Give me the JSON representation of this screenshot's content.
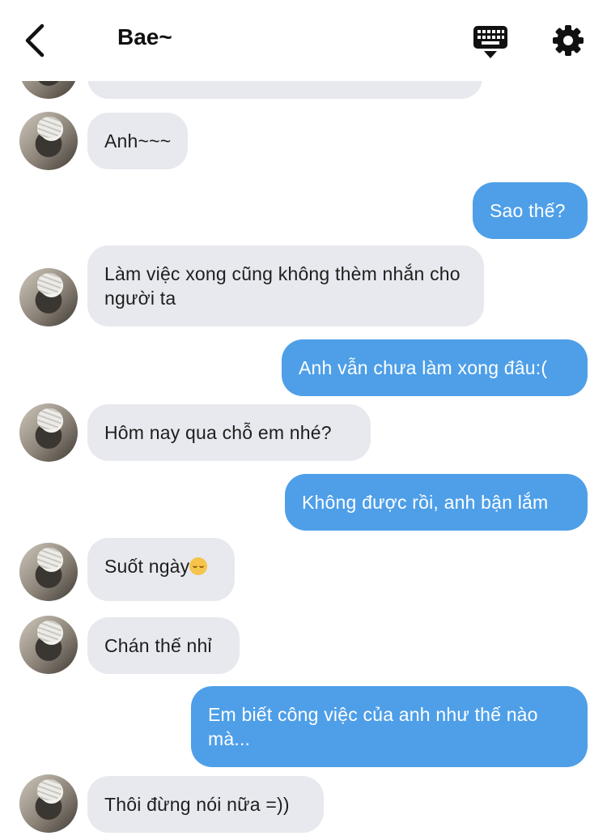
{
  "header": {
    "title": "Bae~",
    "back_icon": "chevron-left-icon",
    "keyboard_icon": "keyboard-icon",
    "settings_icon": "gear-icon"
  },
  "colors": {
    "outgoing_bubble": "#4e9fe8",
    "incoming_bubble": "#e7e9ee"
  },
  "messages": [
    {
      "side": "in",
      "text": ""
    },
    {
      "side": "in",
      "text": "Anh~~~"
    },
    {
      "side": "out",
      "text": "Sao thế?"
    },
    {
      "side": "in",
      "text": "Làm việc xong cũng không thèm nhắn cho người ta"
    },
    {
      "side": "out",
      "text": "Anh vẫn chưa làm xong đâu:("
    },
    {
      "side": "in",
      "text": "Hôm nay qua chỗ em nhé?"
    },
    {
      "side": "out",
      "text": "Không được rồi, anh bận lắm"
    },
    {
      "side": "in",
      "text": "Suốt ngày",
      "emoji": "relieved-face-emoji"
    },
    {
      "side": "in",
      "text": "Chán thế nhỉ"
    },
    {
      "side": "out",
      "text": "Em biết công việc của anh như thế nào mà..."
    },
    {
      "side": "in",
      "text": "Thôi đừng nói nữa =))"
    }
  ]
}
